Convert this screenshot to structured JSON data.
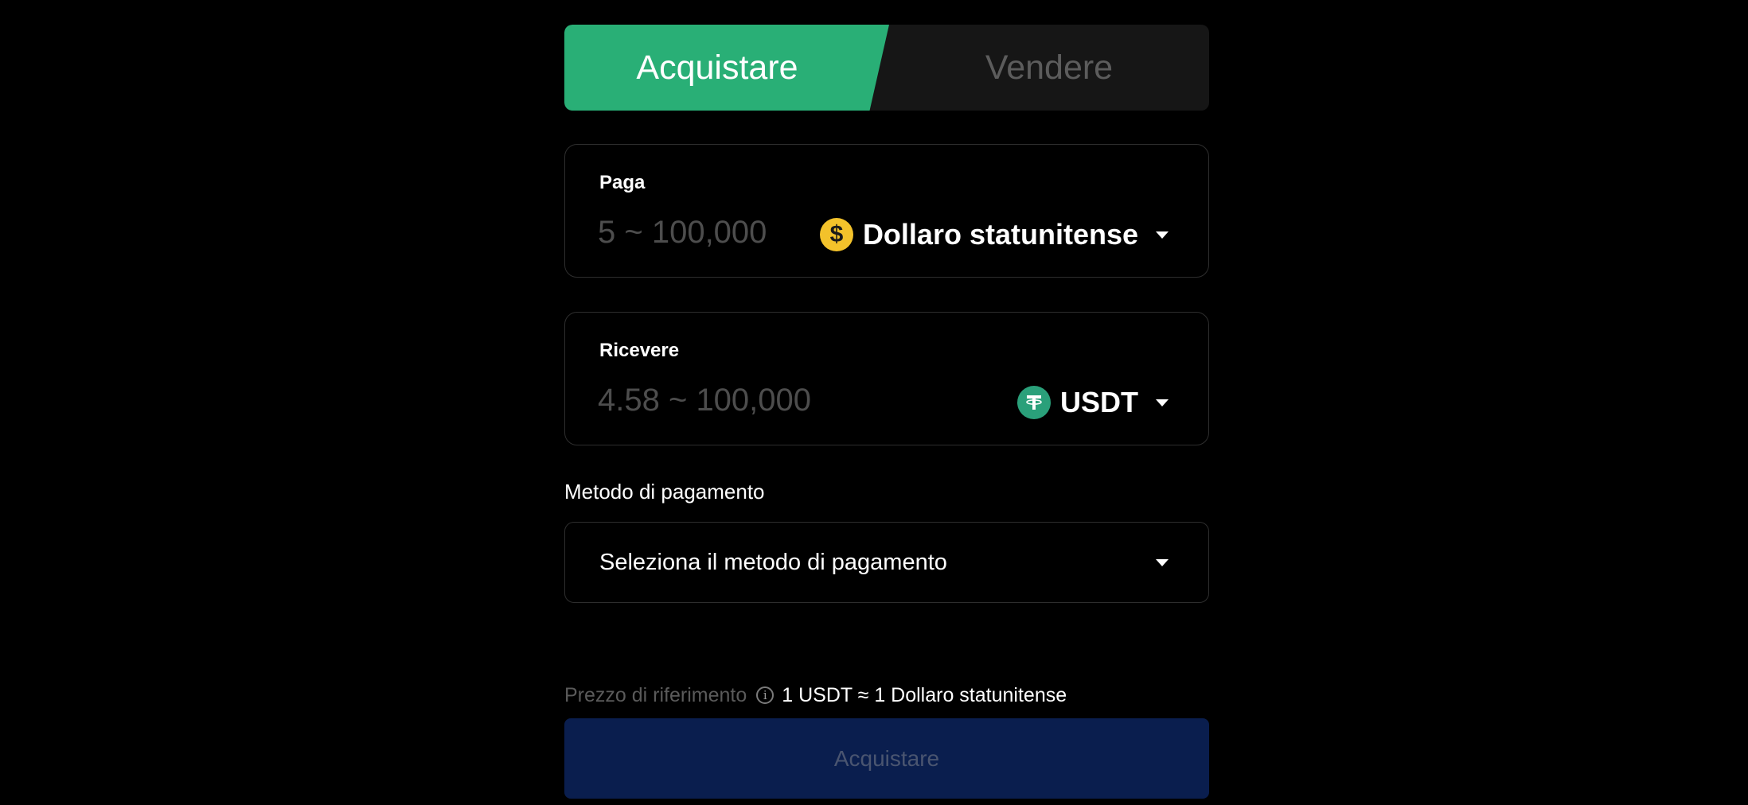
{
  "tabs": {
    "buy_label": "Acquistare",
    "sell_label": "Vendere",
    "active": "buy"
  },
  "pay": {
    "label": "Paga",
    "placeholder": "5 ~ 100,000",
    "currency": "Dollaro statunitense",
    "currency_icon": "dollar-coin-icon",
    "currency_symbol": "$"
  },
  "receive": {
    "label": "Ricevere",
    "placeholder": "4.58 ~ 100,000",
    "currency": "USDT",
    "currency_icon": "tether-icon"
  },
  "payment_method": {
    "label": "Metodo di pagamento",
    "placeholder": "Seleziona il metodo di pagamento"
  },
  "reference": {
    "label": "Prezzo di riferimento",
    "value": "1 USDT ≈ 1 Dollaro statunitense"
  },
  "cta": {
    "label": "Acquistare",
    "enabled": false
  },
  "colors": {
    "background": "#000000",
    "active_tab": "#29af76",
    "inactive_tab": "#161616",
    "cta_disabled": "#0a1e4e",
    "dollar_coin": "#f3c22b",
    "tether": "#2aa07a"
  }
}
